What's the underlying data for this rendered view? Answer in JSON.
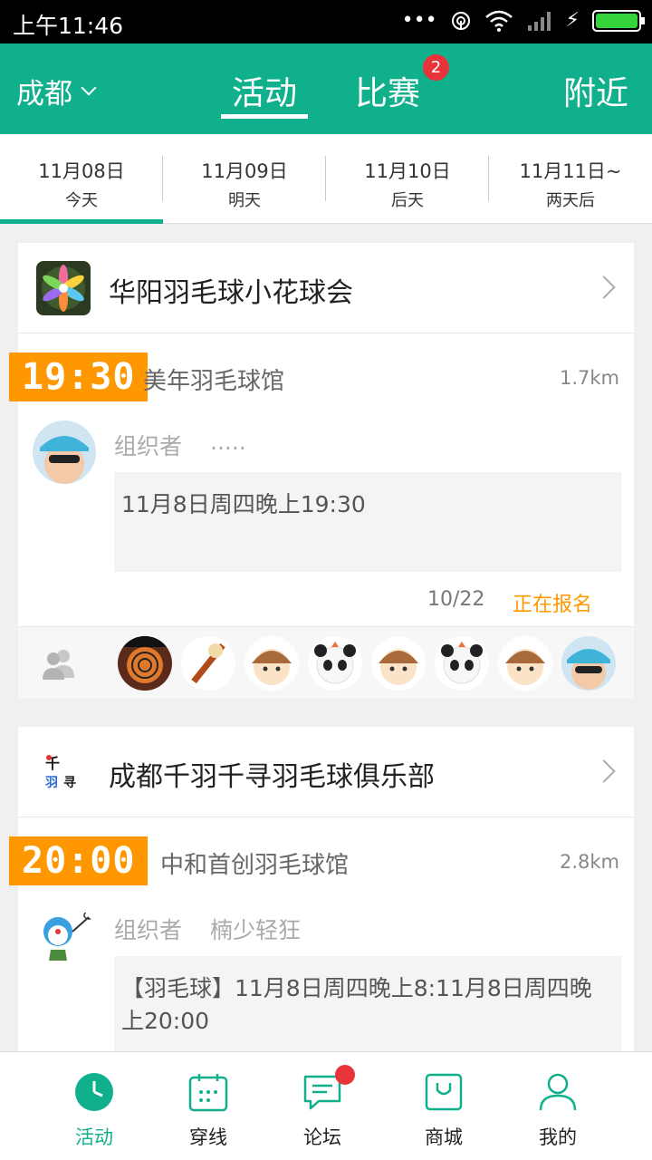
{
  "status_bar": {
    "time": "上午11:46"
  },
  "header": {
    "city": "成都",
    "tabs": [
      {
        "label": "活动",
        "active": true
      },
      {
        "label": "比赛",
        "badge": "2"
      },
      {
        "label": "附近"
      }
    ]
  },
  "dates": [
    {
      "date": "11月08日",
      "day": "今天",
      "active": true
    },
    {
      "date": "11月09日",
      "day": "明天"
    },
    {
      "date": "11月10日",
      "day": "后天"
    },
    {
      "date": "11月11日~",
      "day": "两天后"
    }
  ],
  "cards": [
    {
      "club": "华阳羽毛球小花球会",
      "time": "19:30",
      "venue": "美年羽毛球馆",
      "distance": "1.7km",
      "organizer_label": "组织者",
      "organizer": ".....",
      "description": "11月8日周四晚上19:30",
      "count": "10/22",
      "status": "正在报名"
    },
    {
      "club": "成都千羽千寻羽毛球俱乐部",
      "time": "20:00",
      "venue": "中和首创羽毛球馆",
      "distance": "2.8km",
      "organizer_label": "组织者",
      "organizer": "楠少轻狂",
      "description": "【羽毛球】11月8日周四晚上8:11月8日周四晚上20:00"
    }
  ],
  "bottom_nav": [
    {
      "label": "活动",
      "icon": "clock-icon",
      "active": true
    },
    {
      "label": "穿线",
      "icon": "calendar-icon"
    },
    {
      "label": "论坛",
      "icon": "chat-icon",
      "dot": true
    },
    {
      "label": "商城",
      "icon": "shop-bag-icon"
    },
    {
      "label": "我的",
      "icon": "person-icon"
    }
  ],
  "colors": {
    "brand": "#10b08c",
    "accent": "#ff9800",
    "badge": "#e8333a"
  }
}
